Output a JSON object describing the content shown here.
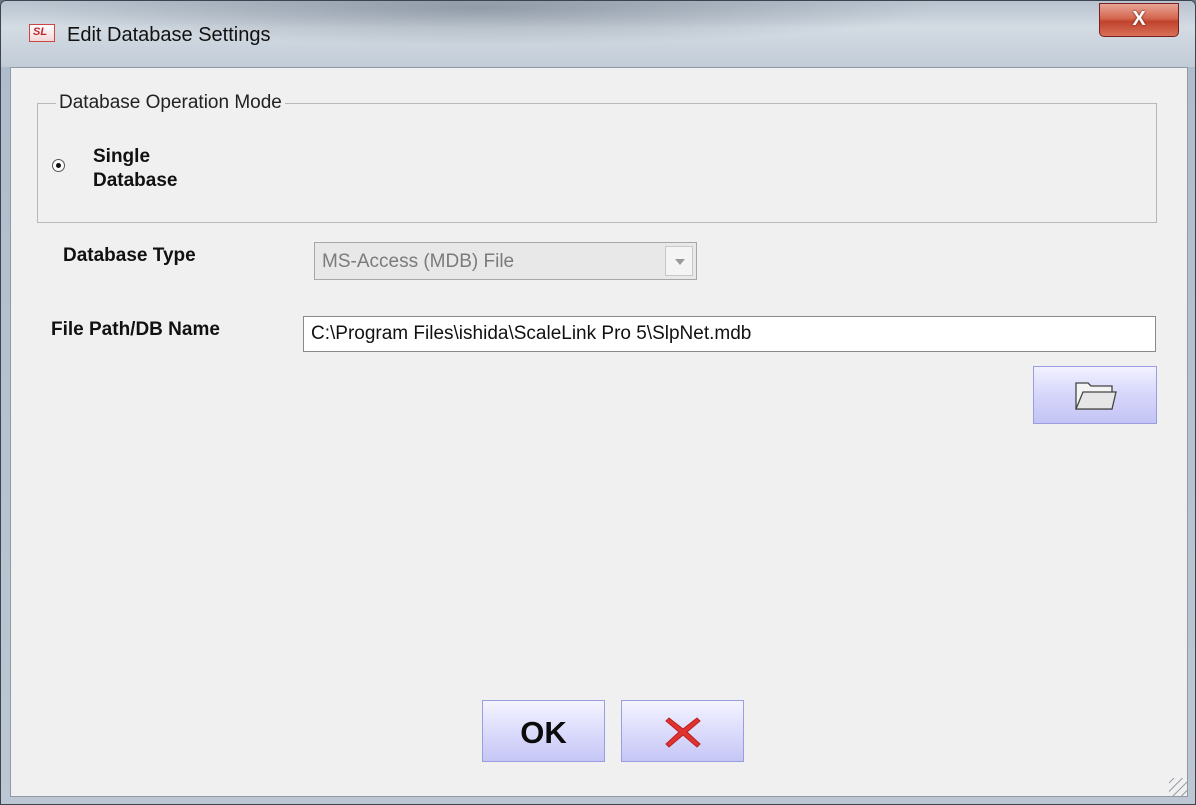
{
  "window": {
    "title": "Edit Database Settings",
    "icon": "app-logo-icon",
    "app_icon_text": "SL",
    "close_label": "X"
  },
  "operation_mode": {
    "legend": "Database Operation Mode",
    "option_label": "Single Database",
    "selected": true
  },
  "database_type": {
    "label": "Database Type",
    "selected_value": "MS-Access (MDB) File",
    "enabled": false
  },
  "file_path": {
    "label": "File Path/DB Name",
    "value": "C:\\Program Files\\ishida\\ScaleLink Pro 5\\SlpNet.mdb",
    "browse_icon": "folder-icon"
  },
  "actions": {
    "ok_label": "OK",
    "cancel_icon": "red-x-icon",
    "cancel_color": "#e0322f"
  }
}
